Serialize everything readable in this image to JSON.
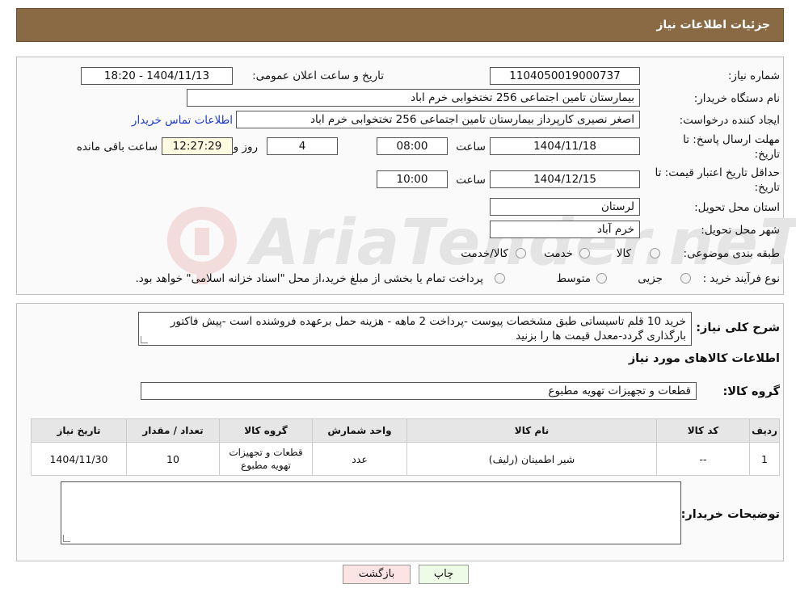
{
  "header": {
    "title": "جزئیات اطلاعات نیاز"
  },
  "watermark": {
    "text": "AriaTender.neT"
  },
  "form": {
    "need_number_label": "شماره نیاز:",
    "need_number": "1104050019000737",
    "announce_label": "تاریخ و ساعت اعلان عمومی:",
    "announce_value": "1404/11/13 - 18:20",
    "buyer_org_label": "نام دستگاه خریدار:",
    "buyer_org": "بیمارستان تامین اجتماعی  256 تختخوابی خرم اباد",
    "creator_label": "ایجاد کننده درخواست:",
    "creator": "اصغر نصیری کارپرداز بیمارستان تامین اجتماعی  256 تختخوابی خرم اباد",
    "contact_link": "اطلاعات تماس خریدار",
    "deadline_label_1": "مهلت ارسال پاسخ: تا",
    "deadline_label_2": "تاریخ:",
    "deadline_date": "1404/11/18",
    "time_label": "ساعت",
    "deadline_time": "08:00",
    "days_value": "4",
    "days_label": "روز و",
    "remaining_time": "12:27:29",
    "remaining_label": "ساعت باقی مانده",
    "validity_label_1": "حداقل تاریخ اعتبار قیمت: تا",
    "validity_label_2": "تاریخ:",
    "validity_date": "1404/12/15",
    "validity_time": "10:00",
    "province_label": "استان محل تحویل:",
    "province": "لرستان",
    "city_label": "شهر محل تحویل:",
    "city": "خرم آباد",
    "category_label": "طبقه بندی موضوعی:",
    "category_options": [
      "کالا",
      "خدمت",
      "کالا/خدمت"
    ],
    "process_label": "نوع فرآیند خرید :",
    "process_options": [
      "جزیی",
      "متوسط"
    ],
    "process_note": "پرداخت تمام یا بخشی از مبلغ خرید،از محل \"اسناد خزانه اسلامی\" خواهد بود."
  },
  "description": {
    "label": "شرح کلی نیاز:",
    "text": "خرید 10 قلم تاسیساتی طبق مشخصات پیوست -پرداخت 2 ماهه - هزینه حمل برعهده فروشنده است -پیش فاکتور بارگذاری گردد-معدل قیمت ها را بزنید"
  },
  "goods": {
    "section_title": "اطلاعات کالاهای مورد نیاز",
    "group_label": "گروه کالا:",
    "group_value": "قطعات و تجهیزات تهویه مطبوع",
    "columns": [
      "ردیف",
      "کد کالا",
      "نام کالا",
      "واحد شمارش",
      "گروه کالا",
      "تعداد / مقدار",
      "تاریخ نیاز"
    ],
    "rows": [
      [
        "1",
        "--",
        "شیر اطمینان (رلیف)",
        "عدد",
        "قطعات و تجهیزات تهویه مطبوع",
        "10",
        "1404/11/30"
      ]
    ]
  },
  "buyer_notes": {
    "label": "توضیحات خریدار:",
    "value": ""
  },
  "buttons": {
    "print": "چاپ",
    "back": "بازگشت"
  },
  "colors": {
    "header_bg": "#8a6a45",
    "link": "#1a3bd0",
    "back_btn_bg": "#fde4e4",
    "print_btn_bg": "#eefbe6"
  }
}
